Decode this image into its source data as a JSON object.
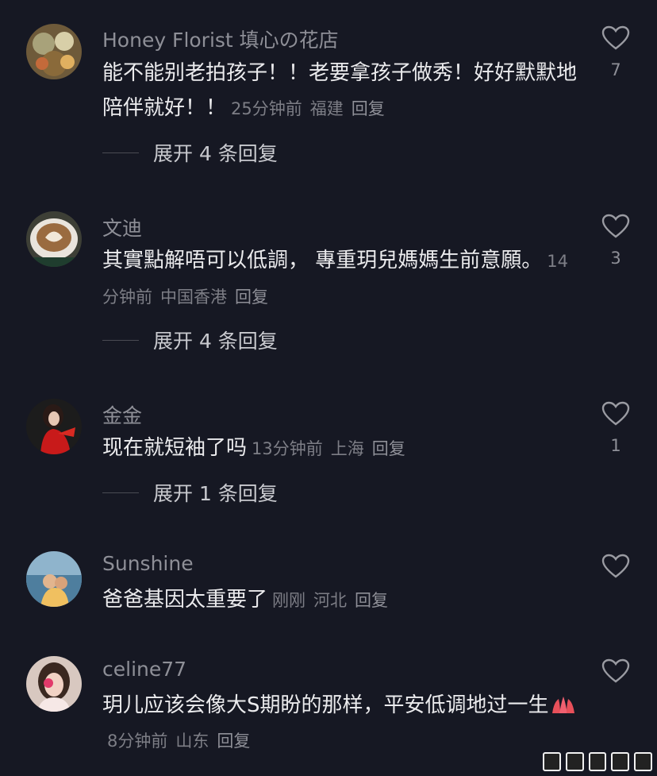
{
  "colors": {
    "background": "#161823",
    "text": "#ebebed",
    "secondary": "#8e8f97"
  },
  "comments": [
    {
      "username": "Honey Florist 填心の花店",
      "text": "能不能别老拍孩子！！老要拿孩子做秀！好好默默地陪伴就好！！",
      "time": "25分钟前",
      "location": "福建",
      "reply": "回复",
      "likes": "7",
      "expand": "展开 4 条回复",
      "avatar_icon": "floral-avatar-icon"
    },
    {
      "username": "文迪",
      "text": "其實點解唔可以低調， 專重玥兒媽媽生前意願。",
      "time": "14分钟前",
      "location": "中国香港",
      "reply": "回复",
      "likes": "3",
      "expand": "展开 4 条回复",
      "avatar_icon": "latte-art-avatar-icon"
    },
    {
      "username": "金金",
      "text": "现在就短袖了吗",
      "time": "13分钟前",
      "location": "上海",
      "reply": "回复",
      "likes": "1",
      "expand": "展开 1 条回复",
      "avatar_icon": "woman-red-dress-avatar-icon"
    },
    {
      "username": "Sunshine",
      "text": "爸爸基因太重要了",
      "time": "刚刚",
      "location": "河北",
      "reply": "回复",
      "likes": "",
      "avatar_icon": "beach-kids-avatar-icon"
    },
    {
      "username": "celine77",
      "text": "玥儿应该会像大S期盼的那样，平安低调地过一生",
      "emoji": "praying-hands-emoji",
      "time": "8分钟前",
      "location": "山东",
      "reply": "回复",
      "likes": "",
      "avatar_icon": "girl-portrait-avatar-icon"
    }
  ]
}
